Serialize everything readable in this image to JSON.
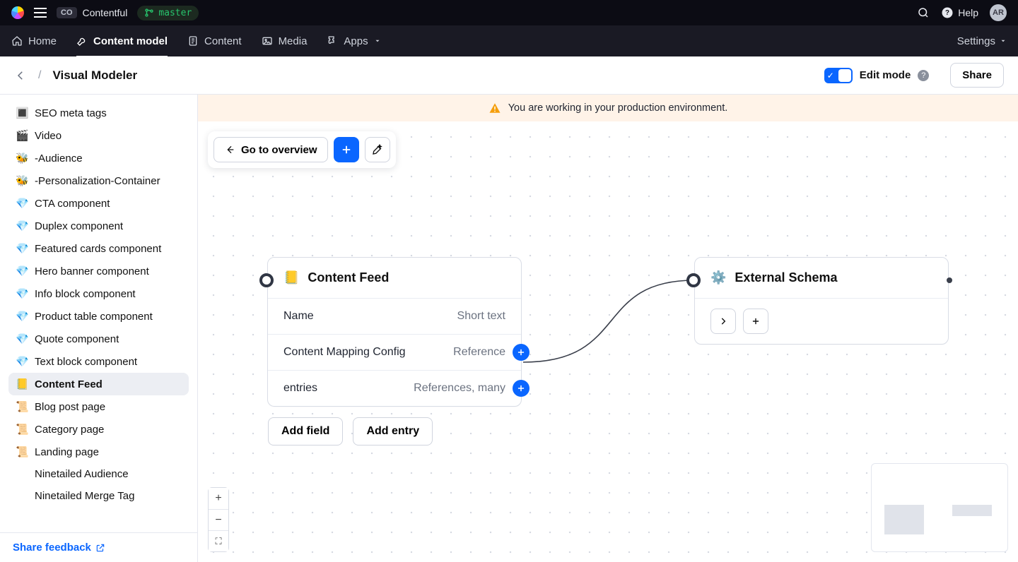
{
  "topbar": {
    "org_badge": "CO",
    "org_name": "Contentful",
    "env_name": "master",
    "help_label": "Help",
    "avatar_initials": "AR"
  },
  "nav": {
    "items": [
      {
        "label": "Home"
      },
      {
        "label": "Content model"
      },
      {
        "label": "Content"
      },
      {
        "label": "Media"
      },
      {
        "label": "Apps"
      }
    ],
    "settings_label": "Settings"
  },
  "page": {
    "title": "Visual Modeler",
    "edit_mode_label": "Edit mode",
    "share_label": "Share"
  },
  "banner": {
    "text": "You are working in your production environment."
  },
  "toolbar": {
    "overview_label": "Go to overview"
  },
  "sidebar": {
    "items": [
      {
        "emoji": "🔳",
        "label": "SEO meta tags"
      },
      {
        "emoji": "🎬",
        "label": "Video"
      },
      {
        "emoji": "🐝",
        "label": "-Audience"
      },
      {
        "emoji": "🐝",
        "label": "-Personalization-Container"
      },
      {
        "emoji": "💎",
        "label": "CTA component"
      },
      {
        "emoji": "💎",
        "label": "Duplex component"
      },
      {
        "emoji": "💎",
        "label": "Featured cards component"
      },
      {
        "emoji": "💎",
        "label": "Hero banner component"
      },
      {
        "emoji": "💎",
        "label": "Info block component"
      },
      {
        "emoji": "💎",
        "label": "Product table component"
      },
      {
        "emoji": "💎",
        "label": "Quote component"
      },
      {
        "emoji": "💎",
        "label": "Text block component"
      },
      {
        "emoji": "📒",
        "label": "Content Feed",
        "active": true
      },
      {
        "emoji": "📜",
        "label": "Blog post page"
      },
      {
        "emoji": "📜",
        "label": "Category page"
      },
      {
        "emoji": "📜",
        "label": "Landing page"
      },
      {
        "emoji": "",
        "label": "Ninetailed Audience"
      },
      {
        "emoji": "",
        "label": "Ninetailed Merge Tag"
      }
    ],
    "feedback_label": "Share feedback"
  },
  "node_content_feed": {
    "title": "Content Feed",
    "emoji": "📒",
    "fields": [
      {
        "name": "Name",
        "type": "Short text",
        "port": false
      },
      {
        "name": "Content Mapping Config",
        "type": "Reference",
        "port": true
      },
      {
        "name": "entries",
        "type": "References, many",
        "port": true
      }
    ],
    "add_field_label": "Add field",
    "add_entry_label": "Add entry"
  },
  "node_external": {
    "title": "External Schema",
    "emoji": "⚙️"
  }
}
